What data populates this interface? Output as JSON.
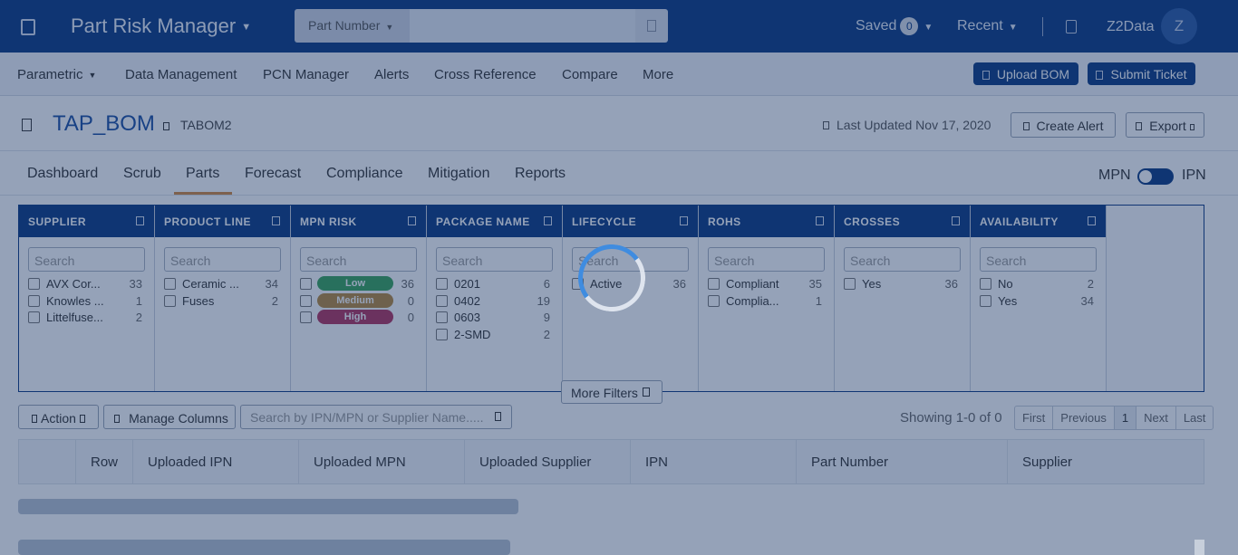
{
  "topbar": {
    "app_title": "Part Risk Manager",
    "search_type": "Part Number",
    "search_value": "",
    "saved_label": "Saved",
    "saved_count": "0",
    "recent_label": "Recent",
    "org_label": "Z2Data",
    "avatar_initial": "Z"
  },
  "nav": {
    "items": [
      "Parametric",
      "Data Management",
      "PCN Manager",
      "Alerts",
      "Cross Reference",
      "Compare",
      "More"
    ],
    "upload_bom": "Upload BOM",
    "submit_ticket": "Submit Ticket"
  },
  "project": {
    "name": "TAP_BOM",
    "code": "TABOM2",
    "last_updated": "Last Updated Nov 17, 2020",
    "create_alert": "Create Alert",
    "export": "Export"
  },
  "tabs": {
    "items": [
      "Dashboard",
      "Scrub",
      "Parts",
      "Forecast",
      "Compliance",
      "Mitigation",
      "Reports"
    ],
    "active": "Parts",
    "toggle_left": "MPN",
    "toggle_right": "IPN"
  },
  "filters": {
    "search_placeholder": "Search",
    "columns": [
      {
        "title": "SUPPLIER",
        "rows": [
          {
            "label": "AVX Cor...",
            "count": "33"
          },
          {
            "label": "Knowles ...",
            "count": "1"
          },
          {
            "label": "Littelfuse...",
            "count": "2"
          }
        ]
      },
      {
        "title": "PRODUCT LINE",
        "rows": [
          {
            "label": "Ceramic ...",
            "count": "34"
          },
          {
            "label": "Fuses",
            "count": "2"
          }
        ]
      },
      {
        "title": "MPN RISK",
        "rows": [
          {
            "label": "Low",
            "count": "36"
          },
          {
            "label": "Medium",
            "count": "0"
          },
          {
            "label": "High",
            "count": "0"
          }
        ]
      },
      {
        "title": "PACKAGE NAME",
        "rows": [
          {
            "label": "0201",
            "count": "6"
          },
          {
            "label": "0402",
            "count": "19"
          },
          {
            "label": "0603",
            "count": "9"
          },
          {
            "label": "2-SMD",
            "count": "2"
          }
        ]
      },
      {
        "title": "LIFECYCLE",
        "rows": [
          {
            "label": "Active",
            "count": "36"
          }
        ]
      },
      {
        "title": "ROHS",
        "rows": [
          {
            "label": "Compliant",
            "count": "35"
          },
          {
            "label": "Complia...",
            "count": "1"
          }
        ]
      },
      {
        "title": "CROSSES",
        "rows": [
          {
            "label": "Yes",
            "count": "36"
          }
        ]
      },
      {
        "title": "AVAILABILITY",
        "rows": [
          {
            "label": "No",
            "count": "2"
          },
          {
            "label": "Yes",
            "count": "34"
          }
        ]
      }
    ],
    "risk_colors": {
      "Low": "#3aa55a",
      "Medium": "#b8893c",
      "High": "#b3335e"
    },
    "more_filters": "More Filters"
  },
  "toolbar": {
    "action": "Action",
    "manage_columns": "Manage Columns",
    "search_placeholder": "Search by IPN/MPN or Supplier Name.....",
    "showing": "Showing 1-0 of 0",
    "pager": [
      "First",
      "Previous",
      "1",
      "Next",
      "Last"
    ]
  },
  "table": {
    "columns": [
      "",
      "Row",
      "Uploaded IPN",
      "Uploaded MPN",
      "Uploaded Supplier",
      "IPN",
      "Part Number",
      "Supplier"
    ]
  },
  "state": {
    "loading": true
  }
}
